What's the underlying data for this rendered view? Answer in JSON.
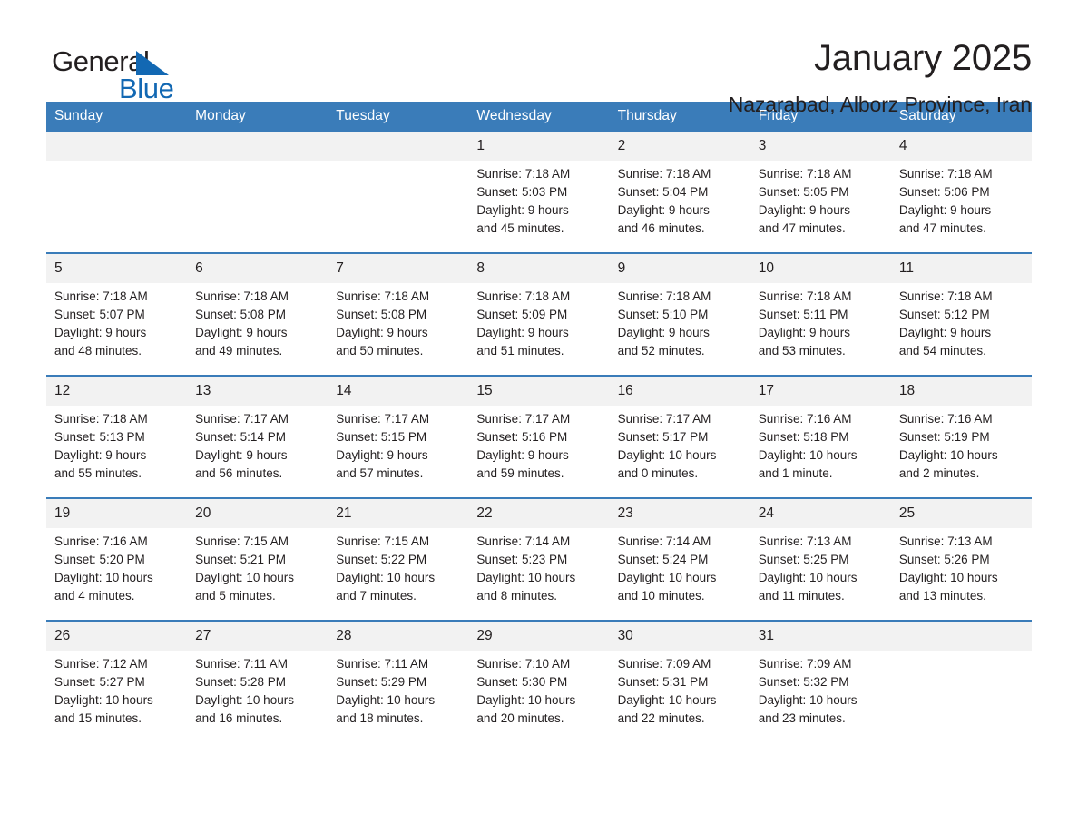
{
  "brand": {
    "name_part1": "General",
    "name_part2": "Blue",
    "triangle_color": "#1268b3"
  },
  "header": {
    "title": "January 2025",
    "subtitle": "Nazarabad, Alborz Province, Iran"
  },
  "theme": {
    "header_bg": "#3a7cb9",
    "daynum_bg": "#f2f2f2",
    "text": "#231f20"
  },
  "weekdays": [
    "Sunday",
    "Monday",
    "Tuesday",
    "Wednesday",
    "Thursday",
    "Friday",
    "Saturday"
  ],
  "weeks": [
    [
      {
        "day": "",
        "blank": true,
        "sunrise": "",
        "sunset": "",
        "daylight1": "",
        "daylight2": ""
      },
      {
        "day": "",
        "blank": true,
        "sunrise": "",
        "sunset": "",
        "daylight1": "",
        "daylight2": ""
      },
      {
        "day": "",
        "blank": true,
        "sunrise": "",
        "sunset": "",
        "daylight1": "",
        "daylight2": ""
      },
      {
        "day": "1",
        "sunrise": "Sunrise: 7:18 AM",
        "sunset": "Sunset: 5:03 PM",
        "daylight1": "Daylight: 9 hours",
        "daylight2": "and 45 minutes."
      },
      {
        "day": "2",
        "sunrise": "Sunrise: 7:18 AM",
        "sunset": "Sunset: 5:04 PM",
        "daylight1": "Daylight: 9 hours",
        "daylight2": "and 46 minutes."
      },
      {
        "day": "3",
        "sunrise": "Sunrise: 7:18 AM",
        "sunset": "Sunset: 5:05 PM",
        "daylight1": "Daylight: 9 hours",
        "daylight2": "and 47 minutes."
      },
      {
        "day": "4",
        "sunrise": "Sunrise: 7:18 AM",
        "sunset": "Sunset: 5:06 PM",
        "daylight1": "Daylight: 9 hours",
        "daylight2": "and 47 minutes."
      }
    ],
    [
      {
        "day": "5",
        "sunrise": "Sunrise: 7:18 AM",
        "sunset": "Sunset: 5:07 PM",
        "daylight1": "Daylight: 9 hours",
        "daylight2": "and 48 minutes."
      },
      {
        "day": "6",
        "sunrise": "Sunrise: 7:18 AM",
        "sunset": "Sunset: 5:08 PM",
        "daylight1": "Daylight: 9 hours",
        "daylight2": "and 49 minutes."
      },
      {
        "day": "7",
        "sunrise": "Sunrise: 7:18 AM",
        "sunset": "Sunset: 5:08 PM",
        "daylight1": "Daylight: 9 hours",
        "daylight2": "and 50 minutes."
      },
      {
        "day": "8",
        "sunrise": "Sunrise: 7:18 AM",
        "sunset": "Sunset: 5:09 PM",
        "daylight1": "Daylight: 9 hours",
        "daylight2": "and 51 minutes."
      },
      {
        "day": "9",
        "sunrise": "Sunrise: 7:18 AM",
        "sunset": "Sunset: 5:10 PM",
        "daylight1": "Daylight: 9 hours",
        "daylight2": "and 52 minutes."
      },
      {
        "day": "10",
        "sunrise": "Sunrise: 7:18 AM",
        "sunset": "Sunset: 5:11 PM",
        "daylight1": "Daylight: 9 hours",
        "daylight2": "and 53 minutes."
      },
      {
        "day": "11",
        "sunrise": "Sunrise: 7:18 AM",
        "sunset": "Sunset: 5:12 PM",
        "daylight1": "Daylight: 9 hours",
        "daylight2": "and 54 minutes."
      }
    ],
    [
      {
        "day": "12",
        "sunrise": "Sunrise: 7:18 AM",
        "sunset": "Sunset: 5:13 PM",
        "daylight1": "Daylight: 9 hours",
        "daylight2": "and 55 minutes."
      },
      {
        "day": "13",
        "sunrise": "Sunrise: 7:17 AM",
        "sunset": "Sunset: 5:14 PM",
        "daylight1": "Daylight: 9 hours",
        "daylight2": "and 56 minutes."
      },
      {
        "day": "14",
        "sunrise": "Sunrise: 7:17 AM",
        "sunset": "Sunset: 5:15 PM",
        "daylight1": "Daylight: 9 hours",
        "daylight2": "and 57 minutes."
      },
      {
        "day": "15",
        "sunrise": "Sunrise: 7:17 AM",
        "sunset": "Sunset: 5:16 PM",
        "daylight1": "Daylight: 9 hours",
        "daylight2": "and 59 minutes."
      },
      {
        "day": "16",
        "sunrise": "Sunrise: 7:17 AM",
        "sunset": "Sunset: 5:17 PM",
        "daylight1": "Daylight: 10 hours",
        "daylight2": "and 0 minutes."
      },
      {
        "day": "17",
        "sunrise": "Sunrise: 7:16 AM",
        "sunset": "Sunset: 5:18 PM",
        "daylight1": "Daylight: 10 hours",
        "daylight2": "and 1 minute."
      },
      {
        "day": "18",
        "sunrise": "Sunrise: 7:16 AM",
        "sunset": "Sunset: 5:19 PM",
        "daylight1": "Daylight: 10 hours",
        "daylight2": "and 2 minutes."
      }
    ],
    [
      {
        "day": "19",
        "sunrise": "Sunrise: 7:16 AM",
        "sunset": "Sunset: 5:20 PM",
        "daylight1": "Daylight: 10 hours",
        "daylight2": "and 4 minutes."
      },
      {
        "day": "20",
        "sunrise": "Sunrise: 7:15 AM",
        "sunset": "Sunset: 5:21 PM",
        "daylight1": "Daylight: 10 hours",
        "daylight2": "and 5 minutes."
      },
      {
        "day": "21",
        "sunrise": "Sunrise: 7:15 AM",
        "sunset": "Sunset: 5:22 PM",
        "daylight1": "Daylight: 10 hours",
        "daylight2": "and 7 minutes."
      },
      {
        "day": "22",
        "sunrise": "Sunrise: 7:14 AM",
        "sunset": "Sunset: 5:23 PM",
        "daylight1": "Daylight: 10 hours",
        "daylight2": "and 8 minutes."
      },
      {
        "day": "23",
        "sunrise": "Sunrise: 7:14 AM",
        "sunset": "Sunset: 5:24 PM",
        "daylight1": "Daylight: 10 hours",
        "daylight2": "and 10 minutes."
      },
      {
        "day": "24",
        "sunrise": "Sunrise: 7:13 AM",
        "sunset": "Sunset: 5:25 PM",
        "daylight1": "Daylight: 10 hours",
        "daylight2": "and 11 minutes."
      },
      {
        "day": "25",
        "sunrise": "Sunrise: 7:13 AM",
        "sunset": "Sunset: 5:26 PM",
        "daylight1": "Daylight: 10 hours",
        "daylight2": "and 13 minutes."
      }
    ],
    [
      {
        "day": "26",
        "sunrise": "Sunrise: 7:12 AM",
        "sunset": "Sunset: 5:27 PM",
        "daylight1": "Daylight: 10 hours",
        "daylight2": "and 15 minutes."
      },
      {
        "day": "27",
        "sunrise": "Sunrise: 7:11 AM",
        "sunset": "Sunset: 5:28 PM",
        "daylight1": "Daylight: 10 hours",
        "daylight2": "and 16 minutes."
      },
      {
        "day": "28",
        "sunrise": "Sunrise: 7:11 AM",
        "sunset": "Sunset: 5:29 PM",
        "daylight1": "Daylight: 10 hours",
        "daylight2": "and 18 minutes."
      },
      {
        "day": "29",
        "sunrise": "Sunrise: 7:10 AM",
        "sunset": "Sunset: 5:30 PM",
        "daylight1": "Daylight: 10 hours",
        "daylight2": "and 20 minutes."
      },
      {
        "day": "30",
        "sunrise": "Sunrise: 7:09 AM",
        "sunset": "Sunset: 5:31 PM",
        "daylight1": "Daylight: 10 hours",
        "daylight2": "and 22 minutes."
      },
      {
        "day": "31",
        "sunrise": "Sunrise: 7:09 AM",
        "sunset": "Sunset: 5:32 PM",
        "daylight1": "Daylight: 10 hours",
        "daylight2": "and 23 minutes."
      },
      {
        "day": "",
        "blank": true,
        "sunrise": "",
        "sunset": "",
        "daylight1": "",
        "daylight2": ""
      }
    ]
  ]
}
